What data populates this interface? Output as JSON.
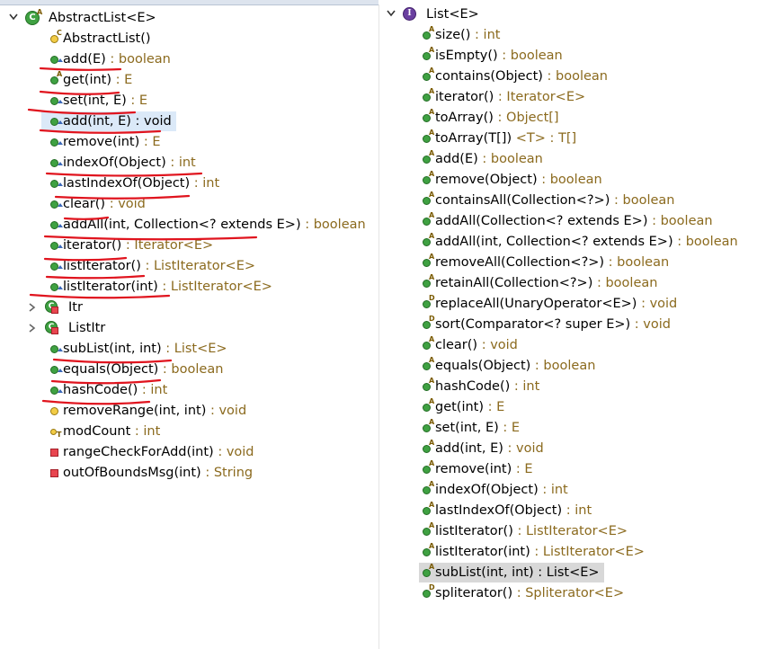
{
  "outline_left": {
    "root": {
      "name": "AbstractList<E>",
      "badge": "A"
    },
    "items": [
      {
        "name": "AbstractList()",
        "type": "",
        "badge": "C"
      },
      {
        "name": "add(E)",
        "type": " : boolean",
        "badge": ""
      },
      {
        "name": "get(int)",
        "type": " : E",
        "badge": "A"
      },
      {
        "name": "set(int, E)",
        "type": " : E",
        "badge": ""
      },
      {
        "name": "add(int, E)",
        "type": " : void",
        "badge": ""
      },
      {
        "name": "remove(int)",
        "type": " : E",
        "badge": ""
      },
      {
        "name": "indexOf(Object)",
        "type": " : int",
        "badge": ""
      },
      {
        "name": "lastIndexOf(Object)",
        "type": " : int",
        "badge": ""
      },
      {
        "name": "clear()",
        "type": " : void",
        "badge": ""
      },
      {
        "name": "addAll(int, Collection<? extends E>)",
        "type": " : boolean",
        "badge": ""
      },
      {
        "name": "iterator()",
        "type": " : Iterator<E>",
        "badge": ""
      },
      {
        "name": "listIterator()",
        "type": " : ListIterator<E>",
        "badge": ""
      },
      {
        "name": "listIterator(int)",
        "type": " : ListIterator<E>",
        "badge": ""
      },
      {
        "name": "Itr",
        "type": "",
        "badge": ""
      },
      {
        "name": "ListItr",
        "type": "",
        "badge": ""
      },
      {
        "name": "subList(int, int)",
        "type": " : List<E>",
        "badge": ""
      },
      {
        "name": "equals(Object)",
        "type": " : boolean",
        "badge": ""
      },
      {
        "name": "hashCode()",
        "type": " : int",
        "badge": ""
      },
      {
        "name": "removeRange(int, int)",
        "type": " : void",
        "badge": ""
      },
      {
        "name": "modCount",
        "type": " : int",
        "badge": "T"
      },
      {
        "name": "rangeCheckForAdd(int)",
        "type": " : void",
        "badge": ""
      },
      {
        "name": "outOfBoundsMsg(int)",
        "type": " : String",
        "badge": ""
      }
    ]
  },
  "outline_right": {
    "root": {
      "name": "List<E>"
    },
    "items": [
      {
        "name": "size()",
        "type": " : int",
        "badge": "A"
      },
      {
        "name": "isEmpty()",
        "type": " : boolean",
        "badge": "A"
      },
      {
        "name": "contains(Object)",
        "type": " : boolean",
        "badge": "A"
      },
      {
        "name": "iterator()",
        "type": " : Iterator<E>",
        "badge": "A"
      },
      {
        "name": "toArray()",
        "type": " : Object[]",
        "badge": "A"
      },
      {
        "name": "toArray(T[])",
        "type": " <T> : T[]",
        "badge": "A"
      },
      {
        "name": "add(E)",
        "type": " : boolean",
        "badge": "A"
      },
      {
        "name": "remove(Object)",
        "type": " : boolean",
        "badge": "A"
      },
      {
        "name": "containsAll(Collection<?>)",
        "type": " : boolean",
        "badge": "A"
      },
      {
        "name": "addAll(Collection<? extends E>)",
        "type": " : boolean",
        "badge": "A"
      },
      {
        "name": "addAll(int, Collection<? extends E>)",
        "type": " : boolean",
        "badge": "A"
      },
      {
        "name": "removeAll(Collection<?>)",
        "type": " : boolean",
        "badge": "A"
      },
      {
        "name": "retainAll(Collection<?>)",
        "type": " : boolean",
        "badge": "A"
      },
      {
        "name": "replaceAll(UnaryOperator<E>)",
        "type": " : void",
        "badge": "D"
      },
      {
        "name": "sort(Comparator<? super E>)",
        "type": " : void",
        "badge": "D"
      },
      {
        "name": "clear()",
        "type": " : void",
        "badge": "A"
      },
      {
        "name": "equals(Object)",
        "type": " : boolean",
        "badge": "A"
      },
      {
        "name": "hashCode()",
        "type": " : int",
        "badge": "A"
      },
      {
        "name": "get(int)",
        "type": " : E",
        "badge": "A"
      },
      {
        "name": "set(int, E)",
        "type": " : E",
        "badge": "A"
      },
      {
        "name": "add(int, E)",
        "type": " : void",
        "badge": "A"
      },
      {
        "name": "remove(int)",
        "type": " : E",
        "badge": "A"
      },
      {
        "name": "indexOf(Object)",
        "type": " : int",
        "badge": "A"
      },
      {
        "name": "lastIndexOf(Object)",
        "type": " : int",
        "badge": "A"
      },
      {
        "name": "listIterator()",
        "type": " : ListIterator<E>",
        "badge": "A"
      },
      {
        "name": "listIterator(int)",
        "type": " : ListIterator<E>",
        "badge": "A"
      },
      {
        "name": "subList(int, int)",
        "type": " : List<E>",
        "badge": "A"
      },
      {
        "name": "spliterator()",
        "type": " : Spliterator<E>",
        "badge": "D"
      }
    ]
  },
  "colors": {
    "return_type": "#8b6a1e",
    "method_green": "#3fa142",
    "private_red": "#e8454f",
    "annotation_red": "#e0141e"
  }
}
